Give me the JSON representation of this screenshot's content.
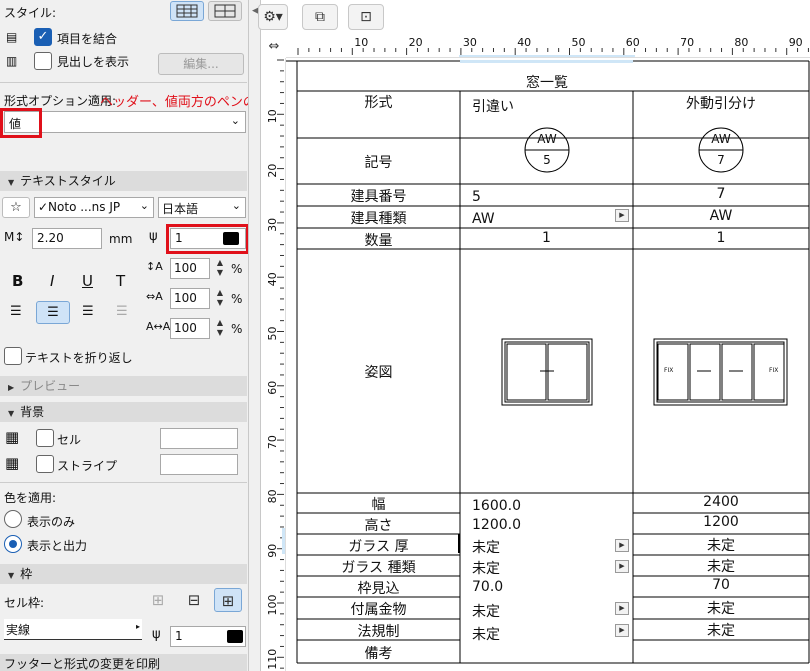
{
  "panel": {
    "style_label": "スタイル:",
    "merge_label": "項目を結合",
    "headings_label": "見出しを表示",
    "edit_button": "編集...",
    "format_option_label": "形式オプション適用:",
    "annotation": "ヘッダー、値両方のペンの色を変更します。",
    "format_select_value": "値",
    "text_style_header": "テキストスタイル",
    "font_value": "✓Noto ...ns JP",
    "language_value": "日本語",
    "size_value": "2.20",
    "size_unit": "mm",
    "pen_value": "1",
    "bold": "B",
    "italic": "I",
    "underline": "U",
    "strike": "T",
    "spacing_1": "100",
    "spacing_2": "100",
    "spacing_3": "100",
    "percent": "%",
    "wrap_label": "テキストを折り返し",
    "preview_header": "プレビュー",
    "background_header": "背景",
    "cell_label": "セル",
    "stripe_label": "ストライプ",
    "color_apply_label": "色を適用:",
    "radio_display_only": "表示のみ",
    "radio_display_output": "表示と出力",
    "frame_header": "枠",
    "cell_frame_label": "セル枠:",
    "line_type_value": "実線",
    "frame_pen_value": "1",
    "footer_header": "フッターと形式の変更を印刷"
  },
  "ruler": {
    "h_ticks": [
      "10",
      "20",
      "30",
      "40",
      "50",
      "60",
      "70",
      "80",
      "90"
    ],
    "v_ticks": [
      "10",
      "20",
      "30",
      "40",
      "50",
      "60",
      "70",
      "80",
      "90",
      "100",
      "110"
    ]
  },
  "schedule": {
    "title": "窓一覧",
    "rows": [
      {
        "label": "形式",
        "v1": "引違い",
        "v2": "外動引分け"
      },
      {
        "label": "記号",
        "v1_top": "AW",
        "v1_bottom": "5",
        "v2_top": "AW",
        "v2_bottom": "7"
      },
      {
        "label": "建具番号",
        "v1": "5",
        "v2": "7"
      },
      {
        "label": "建具種類",
        "v1": "AW",
        "v2": "AW"
      },
      {
        "label": "数量",
        "v1": "1",
        "v2": "1"
      },
      {
        "label": "姿図"
      },
      {
        "label": "幅",
        "v1": "1600.0",
        "v2": "2400"
      },
      {
        "label": "高さ",
        "v1": "1200.0",
        "v2": "1200"
      },
      {
        "label": "ガラス 厚",
        "v1": "未定",
        "v2": "未定"
      },
      {
        "label": "ガラス 種類",
        "v1": "未定",
        "v2": "未定"
      },
      {
        "label": "枠見込",
        "v1": "70.0",
        "v2": "70"
      },
      {
        "label": "付属金物",
        "v1": "未定",
        "v2": "未定"
      },
      {
        "label": "法規制",
        "v1": "未定",
        "v2": "未定"
      },
      {
        "label": "備考",
        "v1": "",
        "v2": ""
      }
    ],
    "elev_side_label": "FIX"
  }
}
